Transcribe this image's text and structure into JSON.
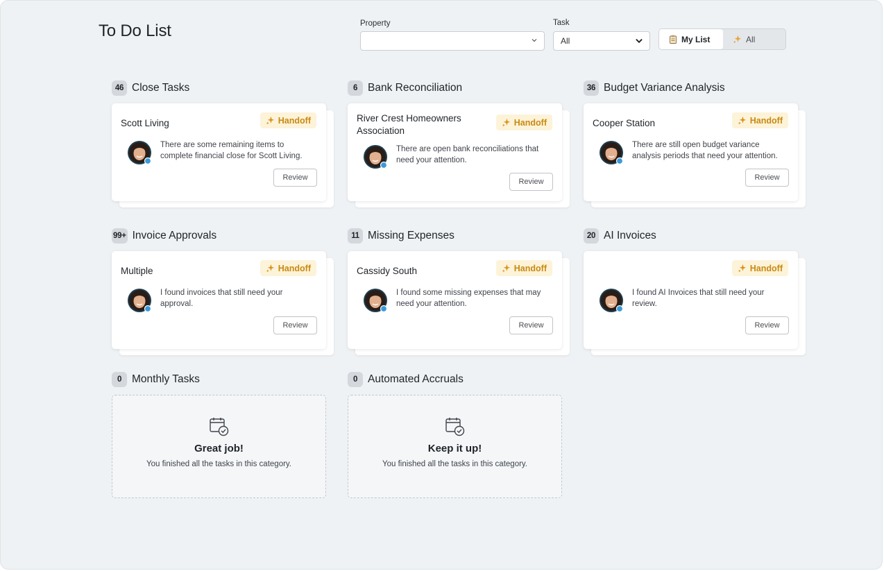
{
  "page": {
    "title": "To Do List"
  },
  "filters": {
    "property": {
      "label": "Property",
      "value": ""
    },
    "task": {
      "label": "Task",
      "value": "All"
    }
  },
  "view_toggle": {
    "my_list": "My List",
    "all": "All",
    "selected": "My List"
  },
  "sections": [
    {
      "count": "46",
      "title": "Close Tasks",
      "card": {
        "title": "Scott Living",
        "tag": "Handoff",
        "message": "There are some remaining items to complete financial close for Scott Living.",
        "button": "Review"
      }
    },
    {
      "count": "6",
      "title": "Bank Reconciliation",
      "card": {
        "title": "River Crest Homeowners Association",
        "tag": "Handoff",
        "message": "There are open bank reconciliations that need your attention.",
        "button": "Review"
      }
    },
    {
      "count": "36",
      "title": "Budget Variance Analysis",
      "card": {
        "title": "Cooper Station",
        "tag": "Handoff",
        "message": "There are still open budget variance analysis periods that need your attention.",
        "button": "Review"
      }
    },
    {
      "count": "99+",
      "title": "Invoice Approvals",
      "card": {
        "title": "Multiple",
        "tag": "Handoff",
        "message": "I found invoices that still need your approval.",
        "button": "Review"
      }
    },
    {
      "count": "11",
      "title": "Missing Expenses",
      "card": {
        "title": "Cassidy South",
        "tag": "Handoff",
        "message": "I found some missing expenses that may need your attention.",
        "button": "Review"
      }
    },
    {
      "count": "20",
      "title": "AI Invoices",
      "card": {
        "title": "",
        "tag": "Handoff",
        "message": "I found AI Invoices that still need your review.",
        "button": "Review"
      }
    },
    {
      "count": "0",
      "title": "Monthly Tasks",
      "empty": {
        "title": "Great job!",
        "text": "You finished all the tasks in this category."
      }
    },
    {
      "count": "0",
      "title": "Automated Accruals",
      "empty": {
        "title": "Keep it up!",
        "text": "You finished all the tasks in this category."
      }
    }
  ],
  "colors": {
    "accent": "#c98a12",
    "handoff_bg": "#fdf3d9",
    "badge_bg": "#d4d7db",
    "page_bg": "#eff2f4"
  },
  "icons": {
    "tag": "sparkle-icon",
    "empty": "calendar-check-icon",
    "my_list": "clipboard-icon",
    "all": "sparkle-icon"
  }
}
